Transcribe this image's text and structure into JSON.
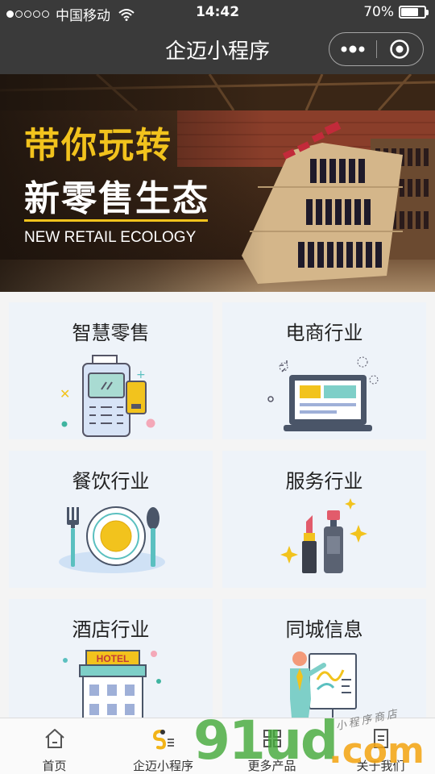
{
  "status_bar": {
    "carrier": "中国移动",
    "time": "14:42",
    "battery": "70%",
    "battery_level": 0.7
  },
  "navbar": {
    "title": "企迈小程序"
  },
  "banner": {
    "line1": "带你玩转",
    "line2": "新零售生态",
    "line3": "NEW RETAIL ECOLOGY"
  },
  "cards": [
    {
      "label": "智慧零售",
      "icon": "pos-terminal-icon"
    },
    {
      "label": "电商行业",
      "icon": "laptop-icon"
    },
    {
      "label": "餐饮行业",
      "icon": "dinner-plate-icon"
    },
    {
      "label": "服务行业",
      "icon": "cosmetics-icon"
    },
    {
      "label": "酒店行业",
      "icon": "hotel-icon"
    },
    {
      "label": "同城信息",
      "icon": "presenter-board-icon"
    }
  ],
  "tabbar": [
    {
      "label": "首页",
      "icon": "home-icon"
    },
    {
      "label": "企迈小程序",
      "icon": "logo-icon"
    },
    {
      "label": "更多产品",
      "icon": "apps-icon"
    },
    {
      "label": "关于我们",
      "icon": "document-icon"
    }
  ],
  "watermark": {
    "main": "91ud",
    "domain": ".com",
    "tagline": "小程序商店"
  },
  "colors": {
    "bar": "#3a3a3a",
    "accent": "#f2c31d",
    "card_bg": "#eef3f9"
  }
}
